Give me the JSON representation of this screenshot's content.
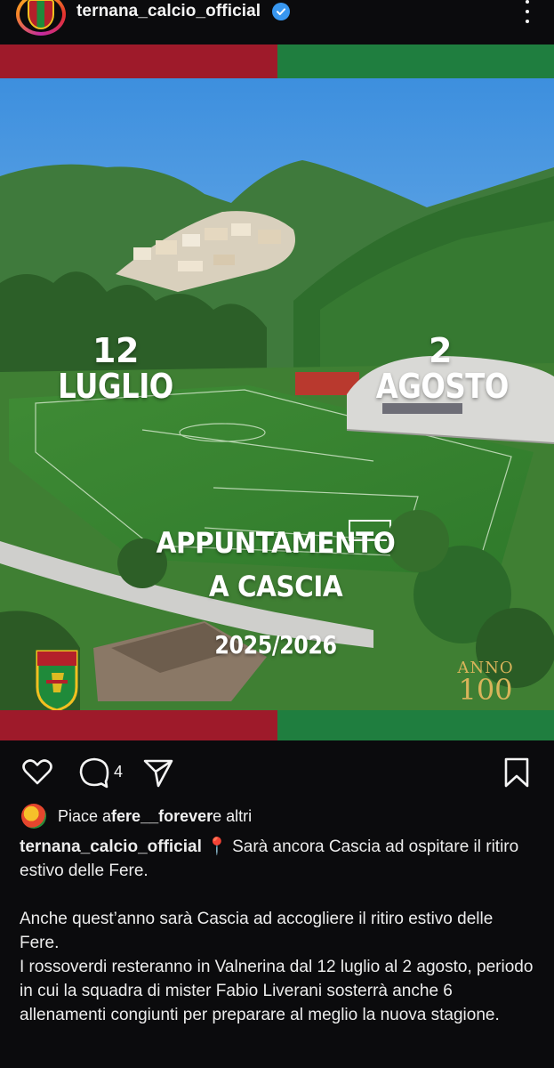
{
  "header": {
    "username": "ternana_calcio_official"
  },
  "post": {
    "overlay": {
      "left_day": "12",
      "left_month": "LUGLIO",
      "right_day": "2",
      "right_month": "AGOSTO",
      "headline_line1": "APPUNTAMENTO",
      "headline_line2": "A CASCIA",
      "season": "2025/2026",
      "crest_text": "TERNANA",
      "anniversary_word": "ANNO",
      "anniversary_number": "100"
    },
    "stripe_colors": {
      "red": "#9e1a2a",
      "green": "#1f7e3f"
    }
  },
  "actions": {
    "comment_count": "4"
  },
  "likes": {
    "prefix": "Piace a ",
    "user": "fere__forever",
    "suffix": " e altri"
  },
  "caption": {
    "username": "ternana_calcio_official",
    "pin": "📍",
    "first_line": " Sarà ancora Cascia ad ospitare il ritiro estivo delle Fere.",
    "paragraph2_line1": "Anche quest’anno sarà Cascia ad accogliere il ritiro estivo delle Fere.",
    "paragraph2_line2": "I rossoverdi resteranno in Valnerina dal 12 luglio al 2 agosto, periodo in cui la squadra di mister Fabio Liverani sosterrà anche 6 allenamenti congiunti per preparare al meglio la nuova stagione."
  },
  "icons": {
    "verified": "verified-badge-icon",
    "more": "more-options-icon",
    "like": "heart-icon",
    "comment": "comment-bubble-icon",
    "share": "paper-plane-icon",
    "save": "bookmark-icon"
  },
  "colors": {
    "background": "#0b0b0d",
    "verified_blue": "#3897f0"
  }
}
